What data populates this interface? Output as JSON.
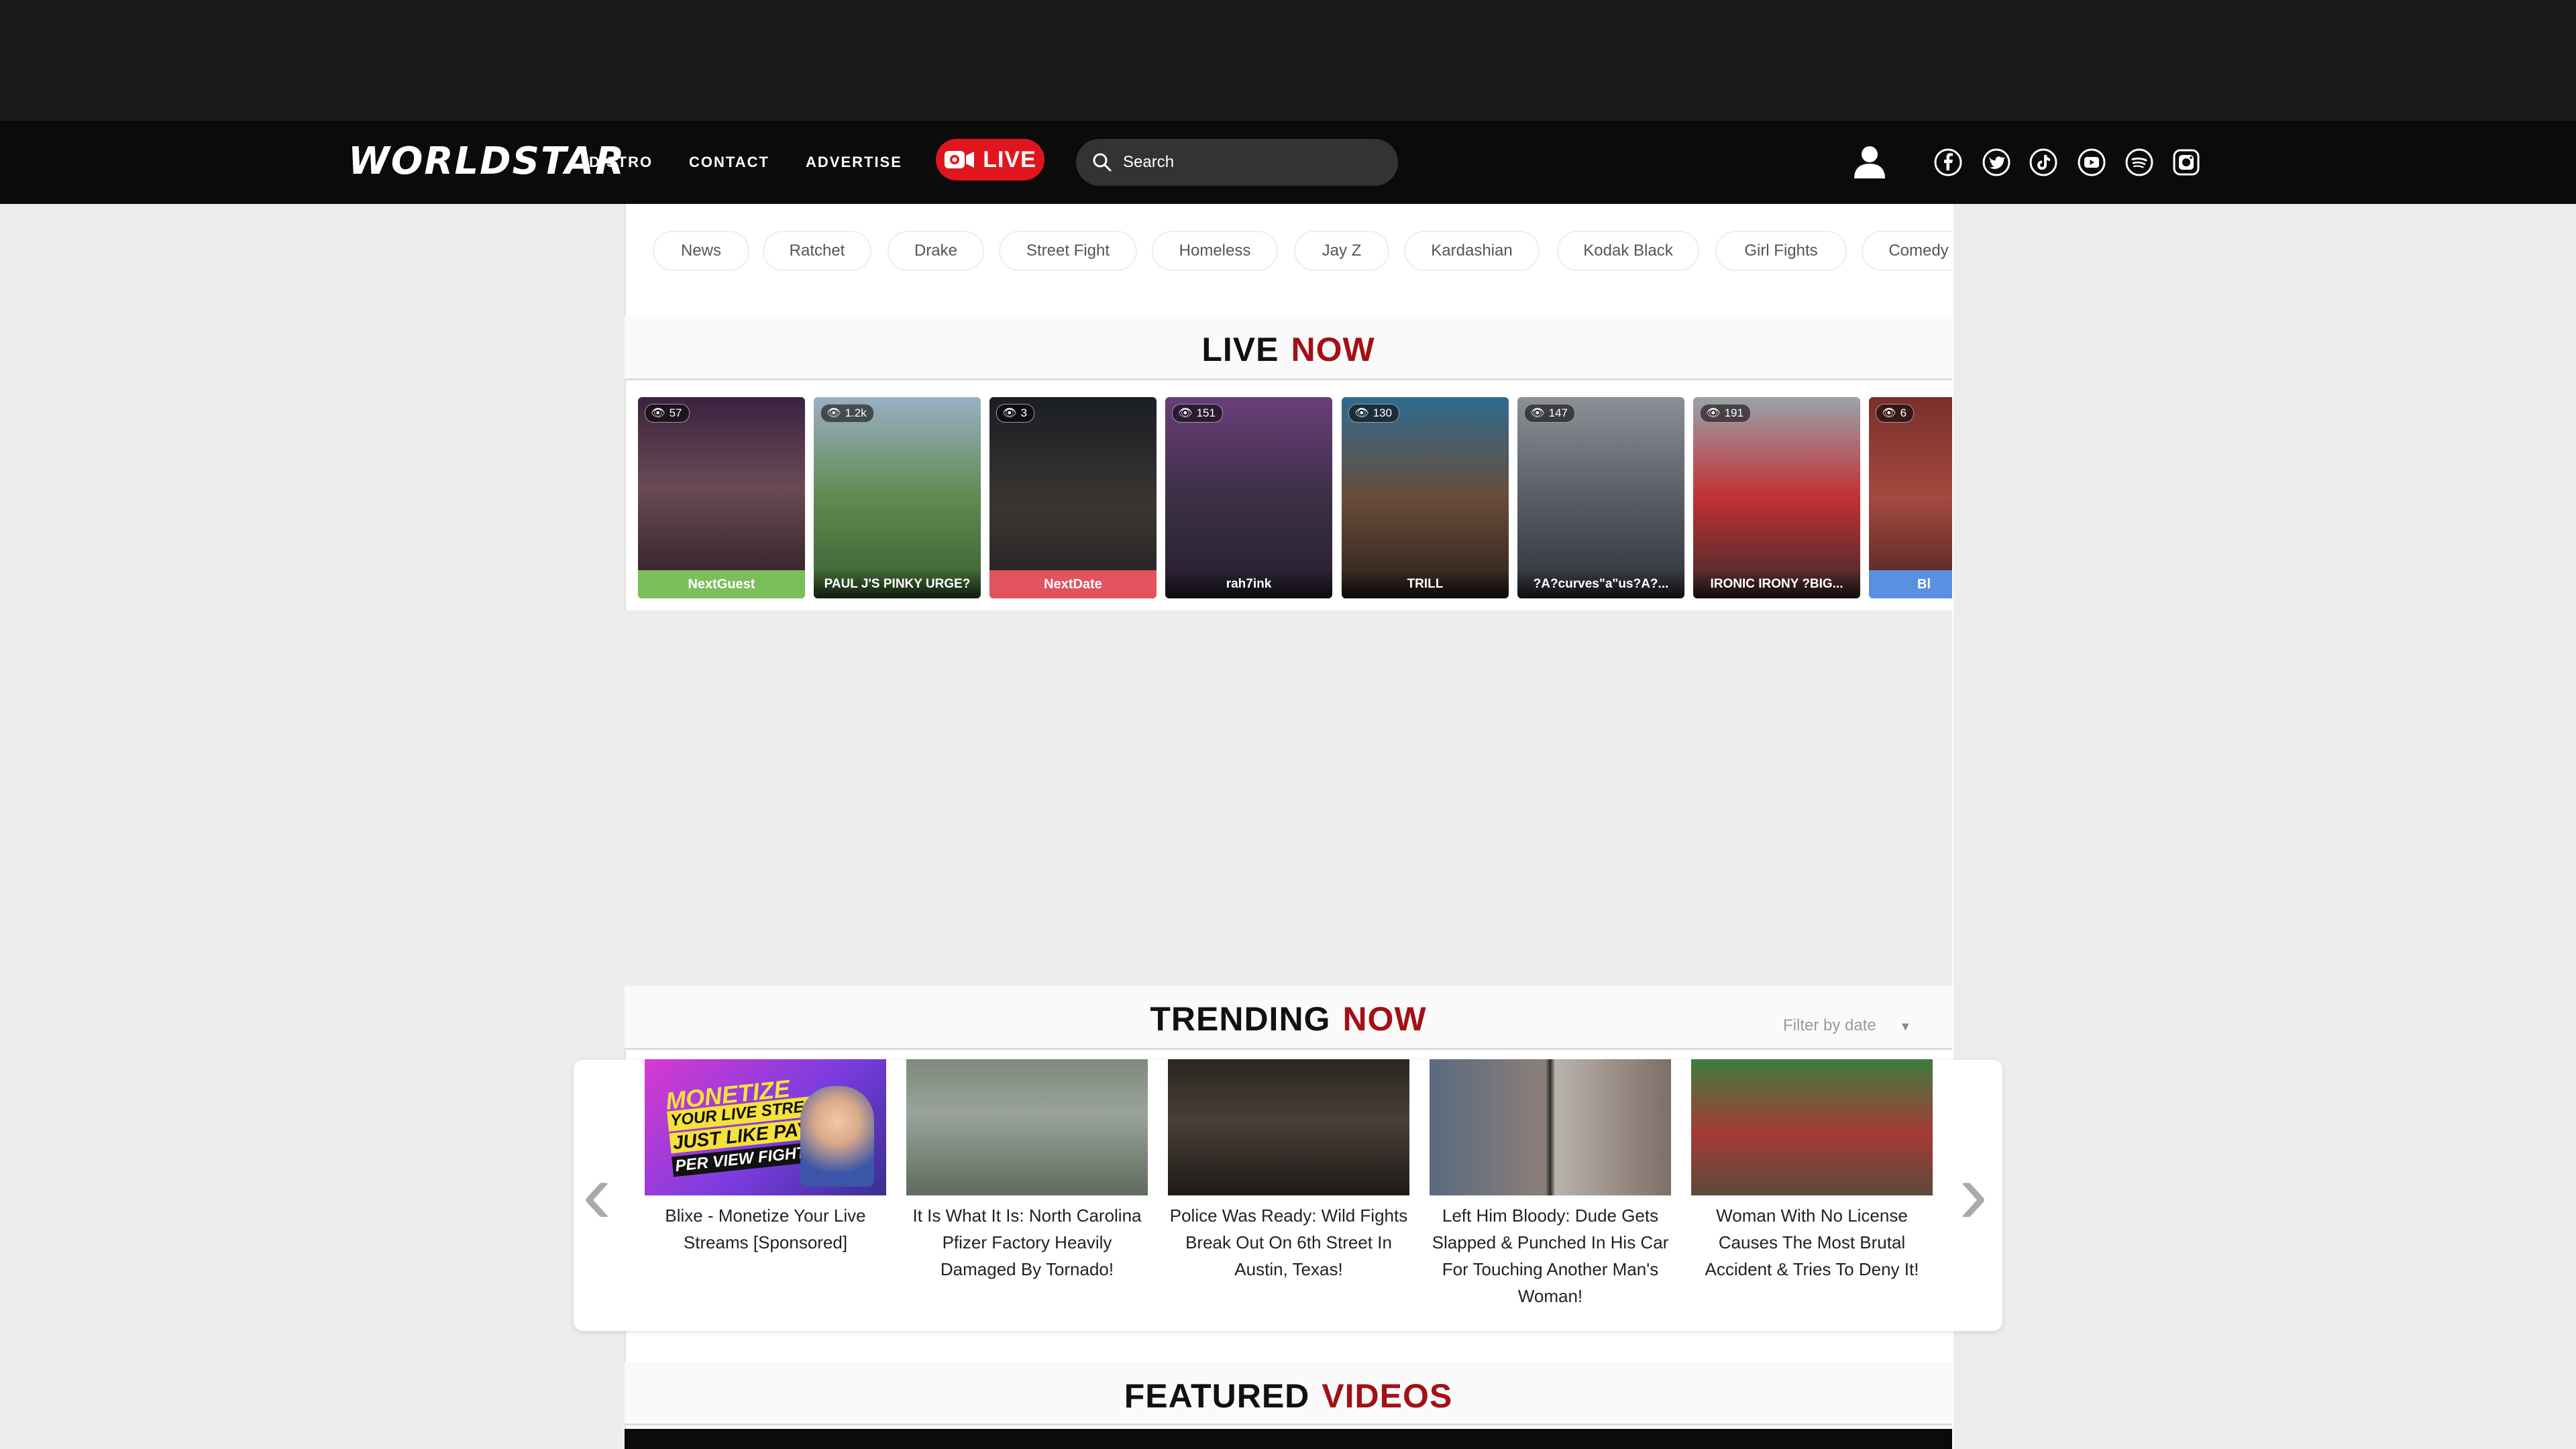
{
  "header": {
    "logo_text": "WORLDSTAR",
    "nav": [
      "DISTRO",
      "CONTACT",
      "ADVERTISE"
    ],
    "live_label": "LIVE",
    "search_placeholder": "Search",
    "social_icons": [
      "facebook-icon",
      "twitter-icon",
      "tiktok-icon",
      "youtube-icon",
      "spotify-icon",
      "instagram-icon"
    ]
  },
  "tags": [
    "News",
    "Ratchet",
    "Drake",
    "Street Fight",
    "Homeless",
    "Jay Z",
    "Kardashian",
    "Kodak Black",
    "Girl Fights",
    "Comedy"
  ],
  "live_now": {
    "title_1": "LIVE",
    "title_2": "NOW",
    "cards": [
      {
        "views": "57",
        "name": "NextGuest"
      },
      {
        "views": "1.2k",
        "name": "PAUL J'S PINKY URGE?"
      },
      {
        "views": "3",
        "name": "NextDate"
      },
      {
        "views": "151",
        "name": "rah7ink"
      },
      {
        "views": "130",
        "name": "TRILL"
      },
      {
        "views": "147",
        "name": "?A?curves\"a\"us?A?..."
      },
      {
        "views": "191",
        "name": "IRONIC IRONY ?BIG..."
      },
      {
        "views": "6",
        "name": "Bl"
      }
    ]
  },
  "trending": {
    "title_1": "TRENDING",
    "title_2": "NOW",
    "filter_label": "Filter by date",
    "thumb1_lines": [
      "MONETIZE",
      "YOUR LIVE STREAMS",
      "JUST LIKE PAY",
      "PER VIEW FIGHT!"
    ],
    "items": [
      {
        "title": "Blixe - Monetize Your Live Streams [Sponsored]"
      },
      {
        "title": "It Is What It Is: North Carolina Pfizer Factory Heavily Damaged By Tornado!"
      },
      {
        "title": "Police Was Ready: Wild Fights Break Out On 6th Street In Austin, Texas!"
      },
      {
        "title": "Left Him Bloody: Dude Gets Slapped & Punched In His Car For Touching Another Man's Woman!"
      },
      {
        "title": "Woman With No License Causes The Most Brutal Accident & Tries To Deny It!"
      }
    ]
  },
  "featured": {
    "title_1": "FEATURED",
    "title_2": "VIDEOS"
  }
}
